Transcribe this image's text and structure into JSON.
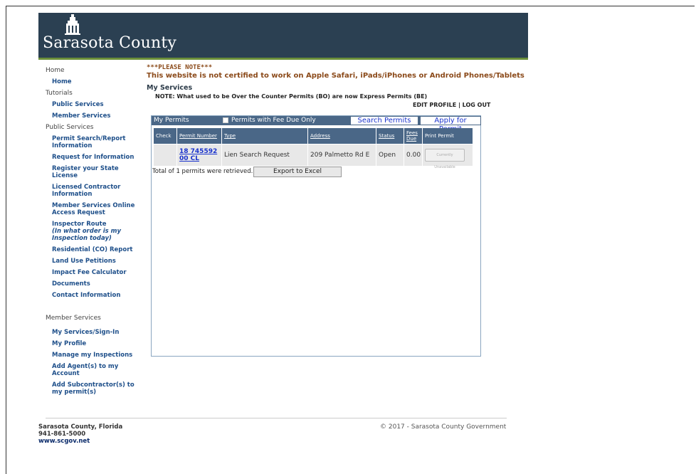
{
  "header": {
    "logo_text": "Sarasota County"
  },
  "sidebar": {
    "sections": [
      {
        "heading": "Home",
        "items": [
          "Home"
        ]
      },
      {
        "heading": "Tutorials",
        "items": [
          "Public Services",
          "Member Services"
        ]
      },
      {
        "heading": "Public Services",
        "items": [
          "Permit Search/Report Information",
          "Request for Information",
          "Register your State License",
          "Licensed Contractor Information",
          "Member Services Online Access Request",
          "Inspector Route",
          "Residential (CO) Report",
          "Land Use Petitions",
          "Impact Fee Calculator",
          "Documents",
          "Contact Information"
        ]
      },
      {
        "heading": "Member Services",
        "items": [
          "My Services/Sign-In",
          "My Profile",
          "Manage my Inspections",
          "Add Agent(s) to my Account",
          "Add Subcontractor(s) to my permit(s)"
        ]
      }
    ],
    "inspector_sub": "(In what order is my Inspection today)"
  },
  "notice": {
    "title": "***PLEASE NOTE***",
    "body": "This website is not certified to work on Apple Safari, iPads/iPhones or Android Phones/Tablets"
  },
  "main": {
    "heading": "My Services",
    "note": "NOTE: What used to be Over the Counter Permits (BO) are now Express Permits (BE)",
    "edit_profile": "EDIT PROFILE",
    "separator": "|",
    "log_out": "LOG OUT"
  },
  "panel": {
    "title": "My Permits",
    "fee_due_label": "Permits with Fee Due Only",
    "search_tab": "Search Permits",
    "apply_tab": "Apply for Permit",
    "columns": [
      "Check",
      "Permit Number",
      "Type",
      "Address",
      "Status",
      "Fees Due",
      "Print Permit"
    ],
    "rows": [
      {
        "check": "",
        "permit_number": "18 745592 00 CL",
        "type": "Lien Search Request",
        "address": "209 Palmetto Rd E",
        "status": "Open",
        "fees_due": "0.00",
        "print": "Currently Unavailable"
      }
    ],
    "total_text": "Total of 1 permits were retrieved.",
    "export_label": "Export to Excel"
  },
  "footer": {
    "org": "Sarasota County, Florida",
    "phone": "941-861-5000",
    "website": "www.scgov.net",
    "copyright": "© 2017 - Sarasota County Government"
  }
}
